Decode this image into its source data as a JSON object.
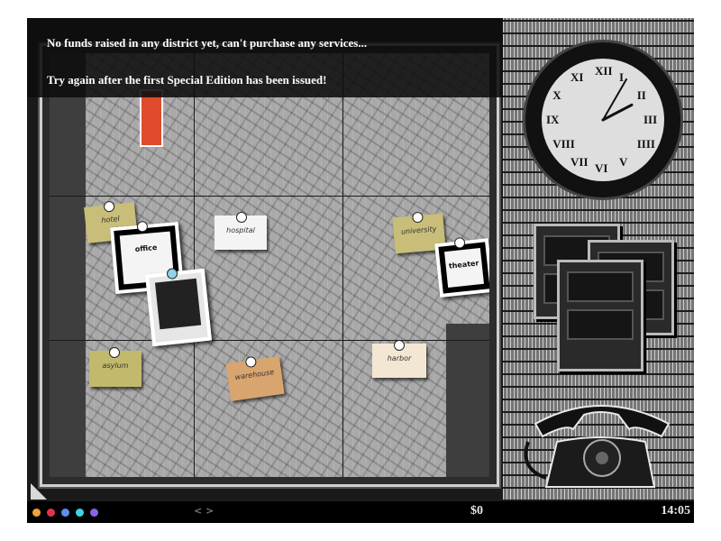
{
  "message": {
    "line1": "No funds raised in any district yet, can't purchase any services...",
    "line2": "Try again after the first Special Edition has been issued!"
  },
  "status_bar": {
    "arrows": "< >",
    "money": "$0",
    "time": "14:05",
    "dot_colors": [
      "#f2a23a",
      "#e0334b",
      "#5d8ff0",
      "#3fd2e8",
      "#8b63e8"
    ]
  },
  "clock": {
    "numerals": [
      "XII",
      "I",
      "II",
      "III",
      "IIII",
      "V",
      "VI",
      "VII",
      "VIII",
      "IX",
      "X",
      "XI"
    ],
    "hour": 2,
    "minute": 5
  },
  "map": {
    "notes": [
      "hotel",
      "hospital",
      "university",
      "asylum",
      "warehouse",
      "harbor"
    ],
    "photo_cards": [
      "office",
      "theater"
    ]
  }
}
